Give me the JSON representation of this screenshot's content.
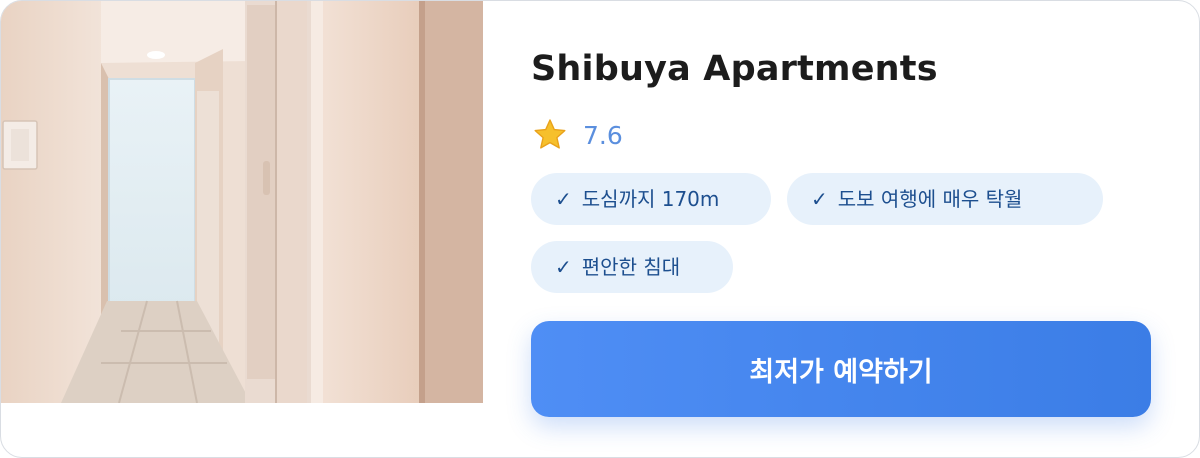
{
  "hotel": {
    "name": "Shibuya Apartments",
    "rating": "7.6",
    "rating_icon": "star-icon",
    "amenities": [
      {
        "check": "✓",
        "label": "도심까지 170m"
      },
      {
        "check": "✓",
        "label": "도보 여행에 매우 탁월"
      },
      {
        "check": "✓",
        "label": "편안한 침대"
      }
    ],
    "book_button_label": "최저가 예약하기"
  },
  "colors": {
    "accent": "#4f8ef5",
    "rating_text": "#5b8fde",
    "tag_bg": "#e7f1fb",
    "tag_text": "#1d4f8f"
  }
}
